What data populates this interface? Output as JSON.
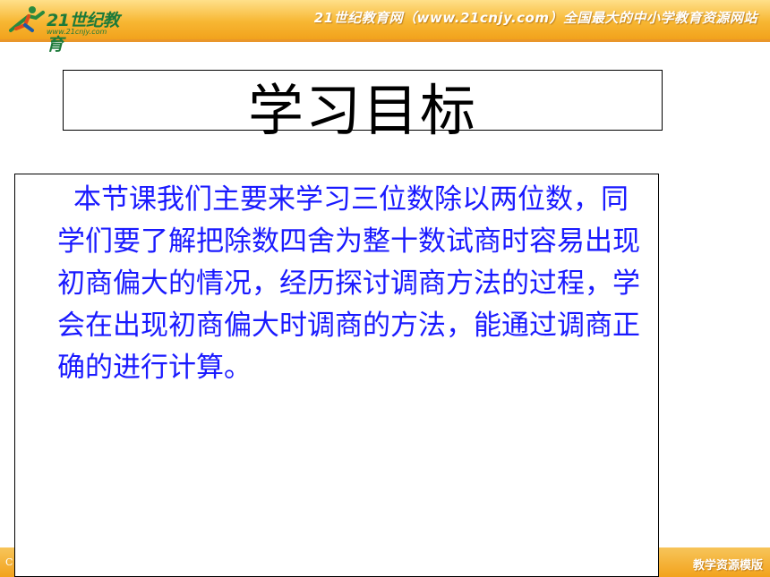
{
  "header": {
    "logo_text": "21世纪教育",
    "logo_url": "www.21cnjy.com",
    "tagline": "21世纪教育网（www.21cnjy.com）全国最大的中小学教育资源网站"
  },
  "slide": {
    "title": "学习目标",
    "body": "本节课我们主要来学习三位数除以两位数，同学们要了解把除数四舍为整十数试商时容易出现初商偏大的情况，经历探讨调商方法的过程，学会在出现初商偏大时调商的方法，能通过调商正确的进行计算。"
  },
  "footer": {
    "left_text": "C",
    "right_text": "教学资源模版"
  },
  "colors": {
    "banner": "#f7b733",
    "body_text": "#1a1aff",
    "logo": "#1d7a3a"
  }
}
